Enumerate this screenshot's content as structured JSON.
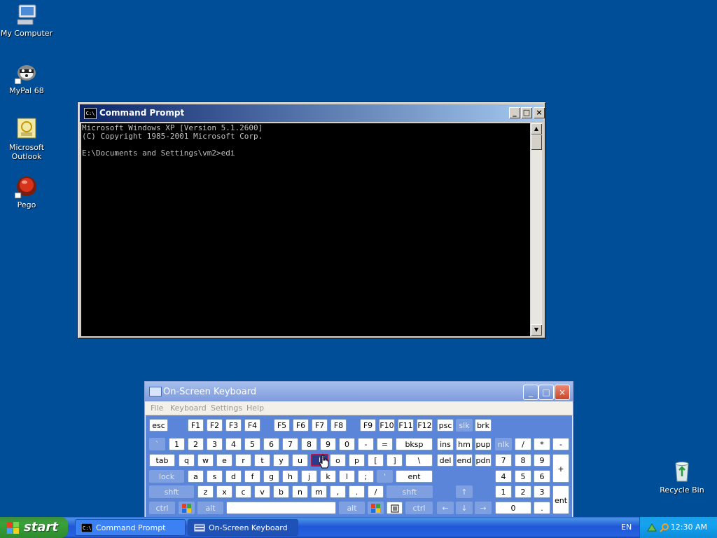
{
  "desktop": {
    "icons": [
      {
        "label": "My Computer",
        "icon": "my-computer-icon"
      },
      {
        "label": "MyPal 68",
        "icon": "mypal-raccoon-icon"
      },
      {
        "label": "Microsoft\nOutlook",
        "icon": "outlook-icon"
      },
      {
        "label": "Pego",
        "icon": "pego-icon"
      },
      {
        "label": "Recycle Bin",
        "icon": "recycle-bin-icon"
      }
    ]
  },
  "cmd": {
    "title": "Command Prompt",
    "icon_text": "C:\\",
    "console": "Microsoft Windows XP [Version 5.1.2600]\n(C) Copyright 1985-2001 Microsoft Corp.\n\nE:\\Documents and Settings\\vm2>edi",
    "minimize": "_",
    "maximize": "□",
    "close": "×"
  },
  "osk": {
    "title": "On-Screen Keyboard",
    "menu": [
      "File",
      "Keyboard",
      "Settings",
      "Help"
    ],
    "keys": {
      "esc": "esc",
      "f1": "F1",
      "f2": "F2",
      "f3": "F3",
      "f4": "F4",
      "f5": "F5",
      "f6": "F6",
      "f7": "F7",
      "f8": "F8",
      "f9": "F9",
      "f10": "F10",
      "f11": "F11",
      "f12": "F12",
      "psc": "psc",
      "slk": "slk",
      "brk": "brk",
      "backtick": "`",
      "n1": "1",
      "n2": "2",
      "n3": "3",
      "n4": "4",
      "n5": "5",
      "n6": "6",
      "n7": "7",
      "n8": "8",
      "n9": "9",
      "n0": "0",
      "minus": "-",
      "equals": "=",
      "bksp": "bksp",
      "ins": "ins",
      "hm": "hm",
      "pup": "pup",
      "nlk": "nlk",
      "kslash": "/",
      "kstar": "*",
      "kminus": "-",
      "tab": "tab",
      "q": "q",
      "w": "w",
      "e": "e",
      "r": "r",
      "t": "t",
      "y": "y",
      "u": "u",
      "i": "i",
      "o": "o",
      "p": "p",
      "lbr": "[",
      "rbr": "]",
      "bslash": "\\",
      "del": "del",
      "end": "end",
      "pdn": "pdn",
      "k7": "7",
      "k8": "8",
      "k9": "9",
      "kplus": "+",
      "lock": "lock",
      "a": "a",
      "s": "s",
      "d": "d",
      "f": "f",
      "g": "g",
      "h": "h",
      "j": "j",
      "k": "k",
      "l": "l",
      "semi": ";",
      "quote": "'",
      "ent": "ent",
      "k4": "4",
      "k5": "5",
      "k6": "6",
      "lshft": "shft",
      "z": "z",
      "x": "x",
      "c": "c",
      "v": "v",
      "b": "b",
      "n": "n",
      "m": "m",
      "comma": ",",
      "period": ".",
      "slash": "/",
      "rshft": "shft",
      "up": "↑",
      "k1": "1",
      "k2": "2",
      "k3": "3",
      "kent": "ent",
      "lctrl": "ctrl",
      "lalt": "alt",
      "ralt": "alt",
      "rctrl": "ctrl",
      "left": "←",
      "down": "↓",
      "right": "→",
      "k0": "0",
      "kdot": "."
    }
  },
  "taskbar": {
    "start": "start",
    "tasks": [
      {
        "label": "Command Prompt",
        "active": false
      },
      {
        "label": "On-Screen Keyboard",
        "active": true
      }
    ],
    "language": "EN",
    "clock": "12:30 AM"
  },
  "colors": {
    "desktop_bg": "#004e98",
    "osk_body": "#5b85d8",
    "highlight_key": "#2d3a8a"
  }
}
